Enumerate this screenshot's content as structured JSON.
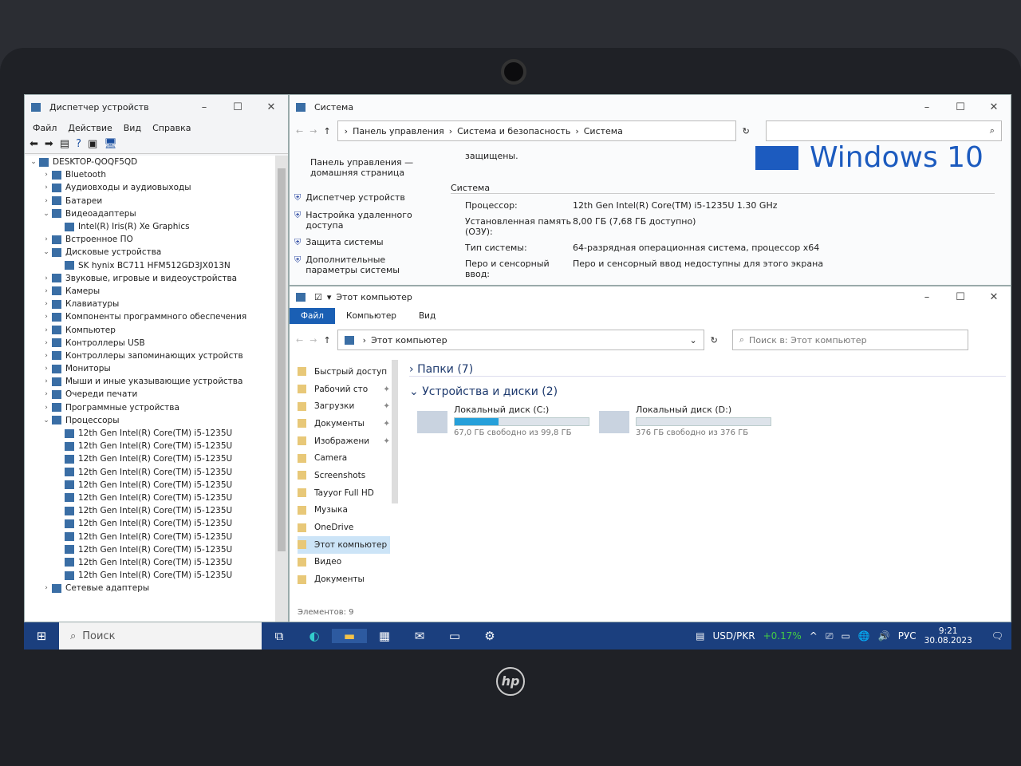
{
  "device_manager": {
    "title": "Диспетчер устройств",
    "menu": [
      "Файл",
      "Действие",
      "Вид",
      "Справка"
    ],
    "tree": [
      {
        "label": "DESKTOP-QOQF5QD",
        "level": 0,
        "exp": "open"
      },
      {
        "label": "Bluetooth",
        "level": 1,
        "exp": "closed"
      },
      {
        "label": "Аудиовходы и аудиовыходы",
        "level": 1,
        "exp": "closed"
      },
      {
        "label": "Батареи",
        "level": 1,
        "exp": "closed"
      },
      {
        "label": "Видеоадаптеры",
        "level": 1,
        "exp": "open"
      },
      {
        "label": "Intel(R) Iris(R) Xe Graphics",
        "level": 2,
        "exp": ""
      },
      {
        "label": "Встроенное ПО",
        "level": 1,
        "exp": "closed"
      },
      {
        "label": "Дисковые устройства",
        "level": 1,
        "exp": "open"
      },
      {
        "label": "SK hynix BC711 HFM512GD3JX013N",
        "level": 2,
        "exp": ""
      },
      {
        "label": "Звуковые, игровые и видеоустройства",
        "level": 1,
        "exp": "closed"
      },
      {
        "label": "Камеры",
        "level": 1,
        "exp": "closed"
      },
      {
        "label": "Клавиатуры",
        "level": 1,
        "exp": "closed"
      },
      {
        "label": "Компоненты программного обеспечения",
        "level": 1,
        "exp": "closed"
      },
      {
        "label": "Компьютер",
        "level": 1,
        "exp": "closed"
      },
      {
        "label": "Контроллеры USB",
        "level": 1,
        "exp": "closed"
      },
      {
        "label": "Контроллеры запоминающих устройств",
        "level": 1,
        "exp": "closed"
      },
      {
        "label": "Мониторы",
        "level": 1,
        "exp": "closed"
      },
      {
        "label": "Мыши и иные указывающие устройства",
        "level": 1,
        "exp": "closed"
      },
      {
        "label": "Очереди печати",
        "level": 1,
        "exp": "closed"
      },
      {
        "label": "Программные устройства",
        "level": 1,
        "exp": "closed"
      },
      {
        "label": "Процессоры",
        "level": 1,
        "exp": "open"
      },
      {
        "label": "12th Gen Intel(R) Core(TM) i5-1235U",
        "level": 2,
        "exp": ""
      },
      {
        "label": "12th Gen Intel(R) Core(TM) i5-1235U",
        "level": 2,
        "exp": ""
      },
      {
        "label": "12th Gen Intel(R) Core(TM) i5-1235U",
        "level": 2,
        "exp": ""
      },
      {
        "label": "12th Gen Intel(R) Core(TM) i5-1235U",
        "level": 2,
        "exp": ""
      },
      {
        "label": "12th Gen Intel(R) Core(TM) i5-1235U",
        "level": 2,
        "exp": ""
      },
      {
        "label": "12th Gen Intel(R) Core(TM) i5-1235U",
        "level": 2,
        "exp": ""
      },
      {
        "label": "12th Gen Intel(R) Core(TM) i5-1235U",
        "level": 2,
        "exp": ""
      },
      {
        "label": "12th Gen Intel(R) Core(TM) i5-1235U",
        "level": 2,
        "exp": ""
      },
      {
        "label": "12th Gen Intel(R) Core(TM) i5-1235U",
        "level": 2,
        "exp": ""
      },
      {
        "label": "12th Gen Intel(R) Core(TM) i5-1235U",
        "level": 2,
        "exp": ""
      },
      {
        "label": "12th Gen Intel(R) Core(TM) i5-1235U",
        "level": 2,
        "exp": ""
      },
      {
        "label": "12th Gen Intel(R) Core(TM) i5-1235U",
        "level": 2,
        "exp": ""
      },
      {
        "label": "Сетевые адаптеры",
        "level": 1,
        "exp": "closed"
      }
    ]
  },
  "system": {
    "title": "Система",
    "breadcrumb": [
      "Панель управления",
      "Система и безопасность",
      "Система"
    ],
    "sidebar_home": "Панель управления — домашняя страница",
    "links": [
      "Диспетчер устройств",
      "Настройка удаленного доступа",
      "Защита системы",
      "Дополнительные параметры системы"
    ],
    "partial_text": "защищены.",
    "logo_text": "Windows 10",
    "section": "Система",
    "props": [
      {
        "k": "Процессор:",
        "v": "12th Gen Intel(R) Core(TM) i5-1235U   1.30 GHz"
      },
      {
        "k": "Установленная память (ОЗУ):",
        "v": "8,00 ГБ (7,68 ГБ доступно)"
      },
      {
        "k": "Тип системы:",
        "v": "64-разрядная операционная система, процессор x64"
      },
      {
        "k": "Перо и сенсорный ввод:",
        "v": "Перо и сенсорный ввод недоступны для этого экрана"
      }
    ]
  },
  "explorer": {
    "title": "Этот компьютер",
    "ribbon": [
      "Файл",
      "Компьютер",
      "Вид"
    ],
    "address": "Этот компьютер",
    "search_placeholder": "Поиск в: Этот компьютер",
    "nav": [
      {
        "label": "Быстрый доступ",
        "pin": false
      },
      {
        "label": "Рабочий сто",
        "pin": true
      },
      {
        "label": "Загрузки",
        "pin": true
      },
      {
        "label": "Документы",
        "pin": true
      },
      {
        "label": "Изображени",
        "pin": true
      },
      {
        "label": "Camera",
        "pin": false
      },
      {
        "label": "Screenshots",
        "pin": false
      },
      {
        "label": "Tayyor Full HD",
        "pin": false
      },
      {
        "label": "Музыка",
        "pin": false
      },
      {
        "label": "OneDrive",
        "pin": false
      },
      {
        "label": "Этот компьютер",
        "pin": false
      },
      {
        "label": "Видео",
        "pin": false
      },
      {
        "label": "Документы",
        "pin": false
      }
    ],
    "folders_group": "Папки (7)",
    "drives_group": "Устройства и диски (2)",
    "drives": [
      {
        "name": "Локальный диск (C:)",
        "free": "67,0 ГБ свободно из 99,8 ГБ",
        "used_fraction": 0.33
      },
      {
        "name": "Локальный диск (D:)",
        "free": "376 ГБ свободно из 376 ГБ",
        "used_fraction": 0.0
      }
    ],
    "status": "Элементов: 9"
  },
  "taskbar": {
    "search": "Поиск",
    "ticker": "USD/PKR",
    "change": "+0.17%",
    "lang": "РУС",
    "time": "9:21",
    "date": "30.08.2023",
    "accent": "#1b3f7e"
  },
  "brand": "hp"
}
